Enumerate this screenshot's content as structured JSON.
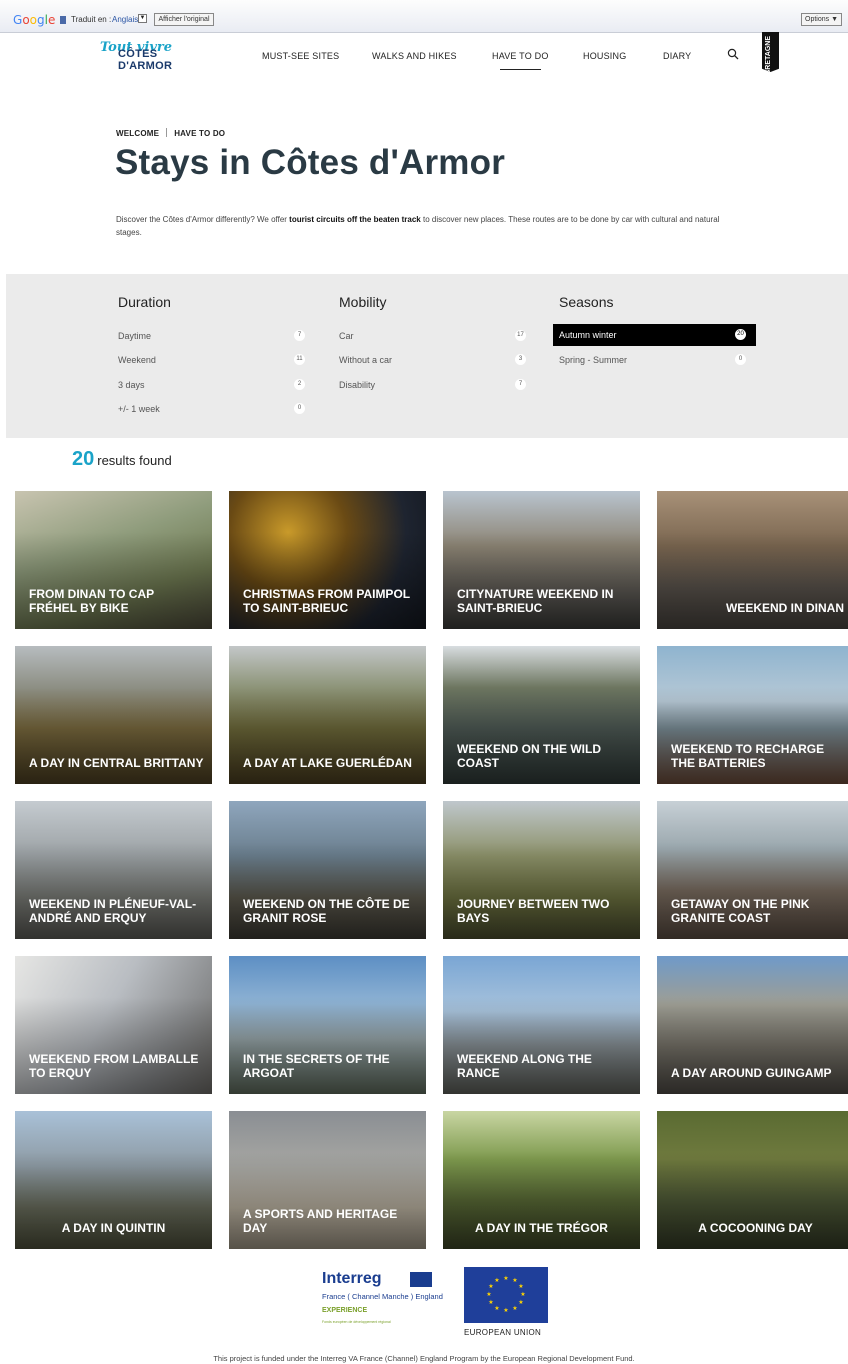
{
  "google_bar": {
    "logo": "Google",
    "translate_label": "Traduit en :",
    "language": "Anglais",
    "show_original": "Afficher l'original",
    "options": "Options ▼"
  },
  "header": {
    "logo_script": "Tout vivre",
    "logo_main": "CÔTES D'ARMOR",
    "nav": [
      "MUST-SEE SITES",
      "WALKS AND HIKES",
      "HAVE TO DO",
      "HOUSING",
      "DIARY"
    ],
    "active_nav": "HAVE TO DO",
    "bretagne": "BRETAGNE"
  },
  "breadcrumb": [
    "WELCOME",
    "HAVE TO DO"
  ],
  "title": "Stays in Côtes d'Armor",
  "intro": {
    "before": "Discover the Côtes d'Armor differently? We offer ",
    "bold": "tourist circuits off the beaten track",
    "after": " to discover new places. These routes are to be done by car with cultural and natural stages."
  },
  "filters": {
    "duration": {
      "heading": "Duration",
      "items": [
        {
          "label": "Daytime",
          "count": "7"
        },
        {
          "label": "Weekend",
          "count": "11"
        },
        {
          "label": "3 days",
          "count": "2"
        },
        {
          "label": "+/- 1 week",
          "count": "0"
        }
      ]
    },
    "mobility": {
      "heading": "Mobility",
      "items": [
        {
          "label": "Car",
          "count": "17"
        },
        {
          "label": "Without a car",
          "count": "3"
        },
        {
          "label": "Disability",
          "count": "7"
        }
      ]
    },
    "seasons": {
      "heading": "Seasons",
      "items": [
        {
          "label": "Autumn winter",
          "count": "20",
          "selected": true
        },
        {
          "label": "Spring - Summer",
          "count": "0"
        }
      ]
    }
  },
  "results": {
    "count": "20",
    "label": "results found"
  },
  "cards": [
    {
      "title": "FROM DINAN TO CAP FRÉHEL BY BIKE"
    },
    {
      "title": "CHRISTMAS FROM PAIMPOL TO SAINT-BRIEUC"
    },
    {
      "title": "CITYNATURE WEEKEND IN SAINT-BRIEUC"
    },
    {
      "title": "WEEKEND IN DINAN"
    },
    {
      "title": "A DAY IN CENTRAL BRITTANY"
    },
    {
      "title": "A DAY AT LAKE GUERLÉDAN"
    },
    {
      "title": "WEEKEND ON THE WILD COAST"
    },
    {
      "title": "WEEKEND TO RECHARGE THE BATTERIES"
    },
    {
      "title": "WEEKEND IN PLÉNEUF-VAL-ANDRÉ AND ERQUY"
    },
    {
      "title": "WEEKEND ON THE CÔTE DE GRANIT ROSE"
    },
    {
      "title": "JOURNEY BETWEEN TWO BAYS"
    },
    {
      "title": "GETAWAY ON THE PINK GRANITE COAST"
    },
    {
      "title": "WEEKEND FROM LAMBALLE TO ERQUY"
    },
    {
      "title": "IN THE SECRETS OF THE ARGOAT"
    },
    {
      "title": "WEEKEND ALONG THE RANCE"
    },
    {
      "title": "A DAY AROUND GUINGAMP"
    },
    {
      "title": "A DAY IN QUINTIN"
    },
    {
      "title": "A SPORTS AND HERITAGE DAY"
    },
    {
      "title": "A DAY IN THE TRÉGOR"
    },
    {
      "title": "A COCOONING DAY"
    }
  ],
  "footer": {
    "interreg_name": "Interreg",
    "interreg_partners": "France ( Channel Manche ) England",
    "interreg_project": "EXPERIENCE",
    "interreg_fund": "Fonds européen de développement régional",
    "eu_label": "EUROPEAN UNION",
    "funding": "This project is funded under the Interreg VA France (Channel) England Program by the European Regional Development Fund."
  },
  "colors": {
    "accent": "#1aa3c8",
    "panel": "#ebebeb",
    "title": "#2a3a44"
  }
}
